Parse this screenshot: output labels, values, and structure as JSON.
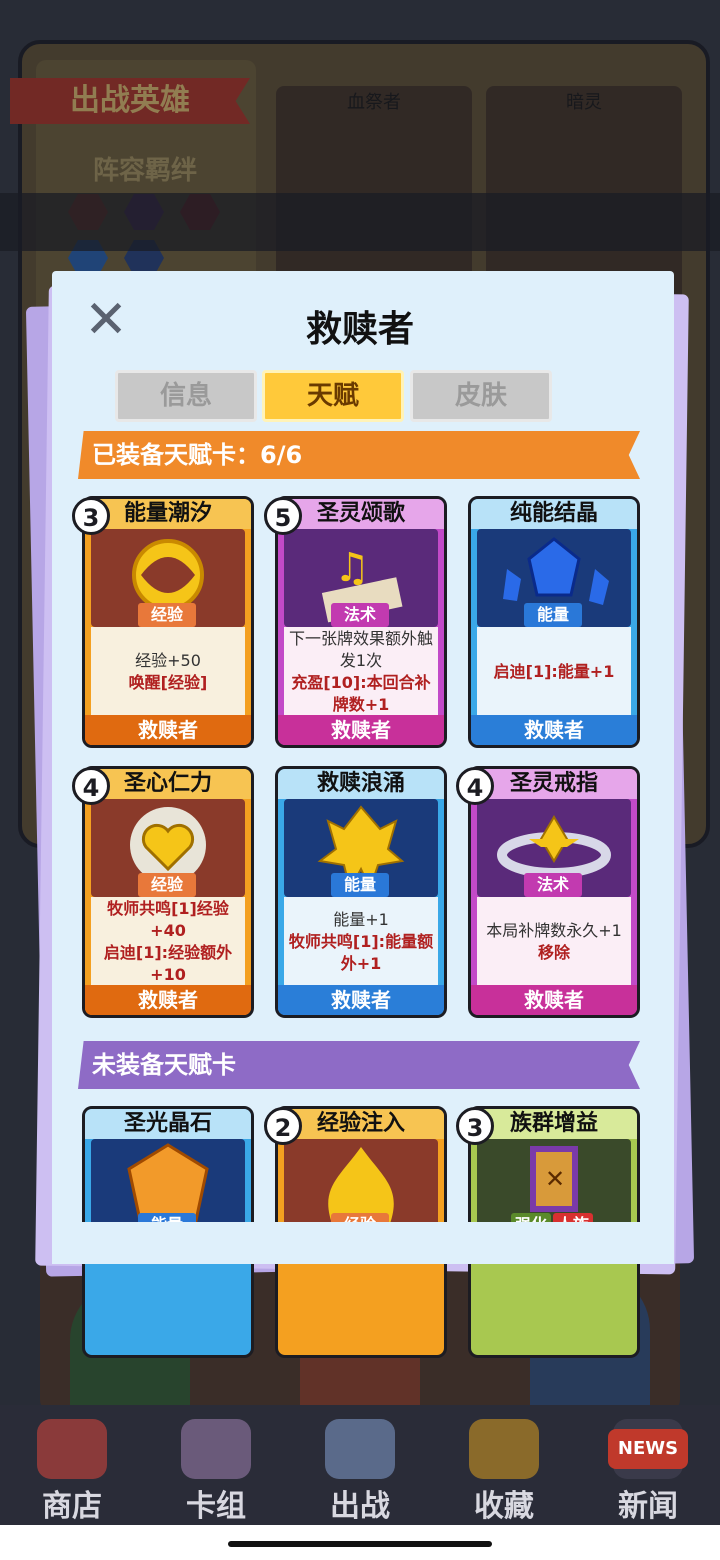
{
  "background": {
    "banner": "出战英雄",
    "bond_label": "阵容羁绊",
    "heroes": [
      {
        "name": "血祭者"
      },
      {
        "name": "暗灵"
      }
    ]
  },
  "modal": {
    "title": "救赎者",
    "close_icon": "close-icon",
    "tabs": [
      {
        "label": "信息",
        "active": false
      },
      {
        "label": "天赋",
        "active": true
      },
      {
        "label": "皮肤",
        "active": false
      }
    ],
    "equipped_header": "已装备天赋卡：6/6",
    "unequipped_header": "未装备天赋卡",
    "equipped_cards": [
      {
        "cost": "3",
        "name": "能量潮汐",
        "type": "经验",
        "lines": [
          {
            "text": "经验+50",
            "hl": false
          },
          {
            "text": "唤醒[经验]",
            "hl": true
          }
        ],
        "owner": "救赎者",
        "theme": "orange"
      },
      {
        "cost": "5",
        "name": "圣灵颂歌",
        "type": "法术",
        "lines": [
          {
            "text": "下一张牌效果额外触发1次",
            "hl": false
          },
          {
            "text": "充盈[10]:本回合补牌数+1",
            "hl": true
          }
        ],
        "owner": "救赎者",
        "theme": "purple"
      },
      {
        "cost": "",
        "name": "纯能结晶",
        "type": "能量",
        "lines": [
          {
            "text": "启迪[1]:能量+1",
            "hl": true
          }
        ],
        "owner": "救赎者",
        "theme": "blue"
      },
      {
        "cost": "4",
        "name": "圣心仁力",
        "type": "经验",
        "lines": [
          {
            "text": "牧师共鸣[1]经验+40",
            "hl": true
          },
          {
            "text": "启迪[1]:经验额外+10",
            "hl": true
          }
        ],
        "owner": "救赎者",
        "theme": "orange"
      },
      {
        "cost": "",
        "name": "救赎浪涌",
        "type": "能量",
        "lines": [
          {
            "text": "能量+1",
            "hl": false
          },
          {
            "text": "牧师共鸣[1]:能量额外+1",
            "hl": true
          }
        ],
        "owner": "救赎者",
        "theme": "blue"
      },
      {
        "cost": "4",
        "name": "圣灵戒指",
        "type": "法术",
        "lines": [
          {
            "text": "本局补牌数永久+1",
            "hl": false
          },
          {
            "text": "移除",
            "hl": true
          }
        ],
        "owner": "救赎者",
        "theme": "purple"
      }
    ],
    "unequipped_cards": [
      {
        "cost": "",
        "name": "圣光晶石",
        "type": "能量",
        "theme": "blue"
      },
      {
        "cost": "2",
        "name": "经验注入",
        "type": "经验",
        "theme": "orange"
      },
      {
        "cost": "3",
        "name": "族群增益",
        "type": "强化",
        "type2": "人族",
        "theme": "green"
      }
    ]
  },
  "navbar": {
    "items": [
      {
        "label": "商店",
        "icon": "shop-icon"
      },
      {
        "label": "卡组",
        "icon": "deck-icon"
      },
      {
        "label": "出战",
        "icon": "battle-icon"
      },
      {
        "label": "收藏",
        "icon": "collection-icon"
      },
      {
        "label": "新闻",
        "icon": "news-icon",
        "badge": "NEWS"
      }
    ]
  },
  "colors": {
    "orange_header": "#f08a2a",
    "purple_header": "#8e6bc6",
    "modal_bg": "#dff0fb",
    "active_tab": "#ffc93a"
  }
}
